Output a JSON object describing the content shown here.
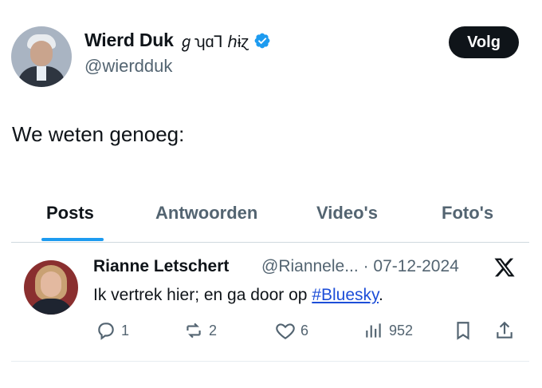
{
  "profile": {
    "display_name": "Wierd Duk",
    "name_glyphs": "ℊʮɑ⅂ ℎɨɀ",
    "handle": "@wierdduk",
    "follow_label": "Volg",
    "verified_color": "#1d9bf0"
  },
  "tweet": {
    "text": "We weten genoeg:"
  },
  "tabs": [
    {
      "label": "Posts",
      "active": true
    },
    {
      "label": "Antwoorden",
      "active": false
    },
    {
      "label": "Video's",
      "active": false
    },
    {
      "label": "Foto's",
      "active": false
    }
  ],
  "embedded_post": {
    "name": "Rianne Letschert",
    "handle": "@Riannele...",
    "date": "07-12-2024",
    "text_before": "Ik vertrek hier; en ga door op ",
    "hashtag": "#Bluesky",
    "text_after": ".",
    "reply_count": "1",
    "repost_count": "2",
    "like_count": "6",
    "view_count": "952",
    "platform_icon": "x-logo-icon"
  },
  "colors": {
    "accent": "#1d9bf0",
    "text_primary": "#0f1419",
    "text_secondary": "#536471"
  }
}
